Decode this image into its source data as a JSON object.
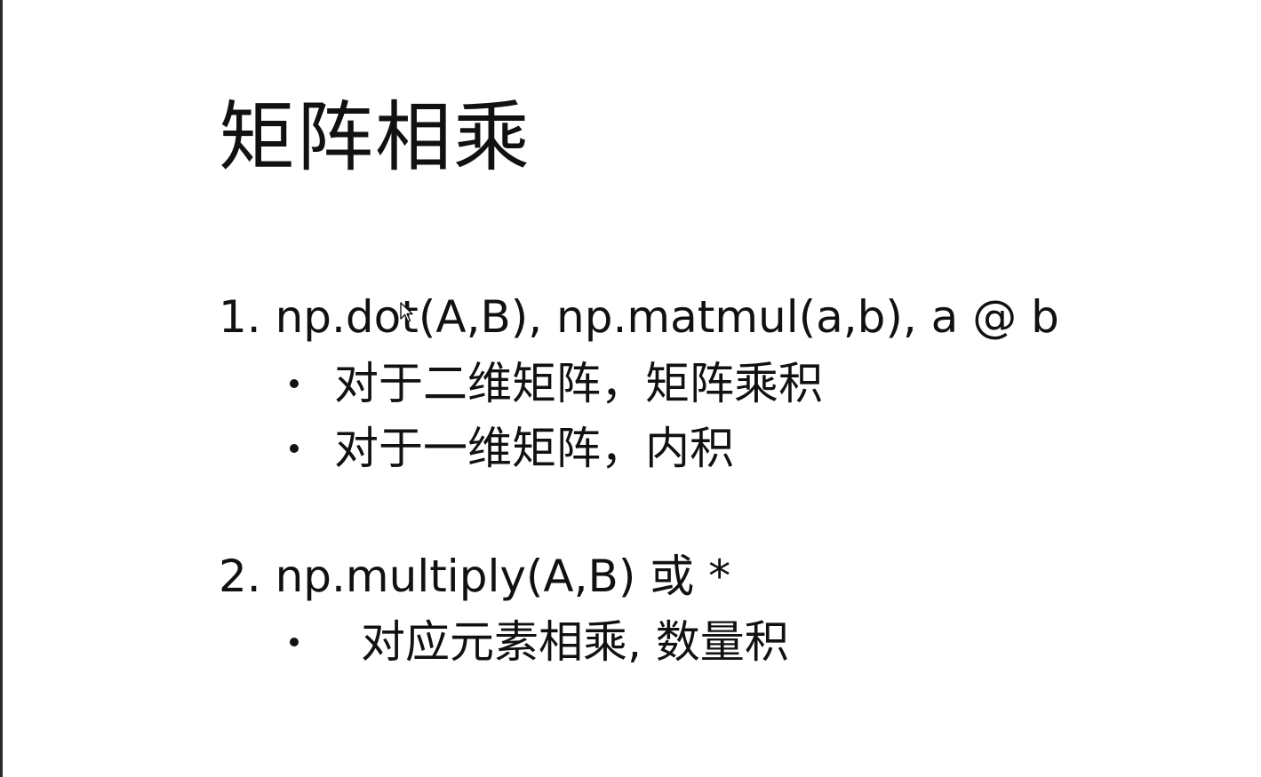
{
  "slide": {
    "title": "矩阵相乘",
    "item1": {
      "text": "1. np.dot(A,B), np.matmul(a,b), a @ b",
      "bullets": [
        "对于二维矩阵，矩阵乘积",
        "对于一维矩阵，内积"
      ]
    },
    "item2": {
      "text": "2.  np.multiply(A,B)   或 *",
      "bullets": [
        "对应元素相乘, 数量积"
      ]
    }
  }
}
